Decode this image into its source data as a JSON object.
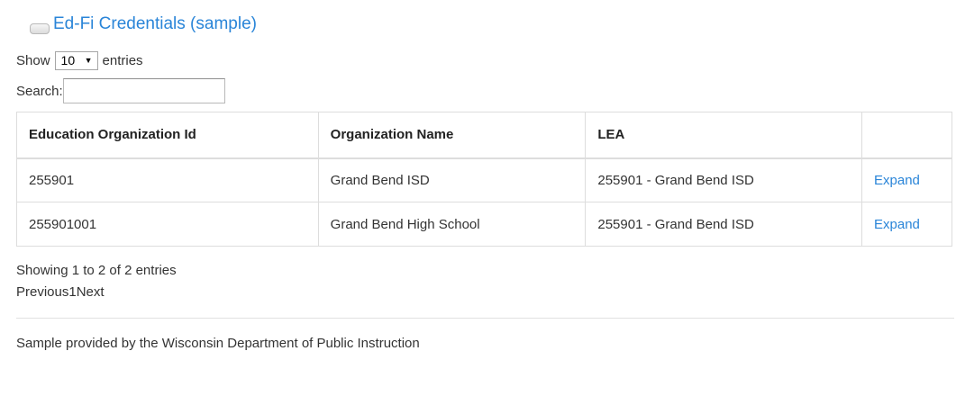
{
  "header": {
    "title": "Ed-Fi Credentials (sample)"
  },
  "length_menu": {
    "show_label": "Show",
    "selected_value": "10",
    "entries_label": "entries"
  },
  "search": {
    "label": "Search:",
    "value": ""
  },
  "table": {
    "columns": [
      "Education Organization Id",
      "Organization Name",
      "LEA",
      ""
    ],
    "rows": [
      {
        "ed_org_id": "255901",
        "org_name": "Grand Bend ISD",
        "lea": "255901 - Grand Bend ISD",
        "action": "Expand"
      },
      {
        "ed_org_id": "255901001",
        "org_name": "Grand Bend High School",
        "lea": "255901 - Grand Bend ISD",
        "action": "Expand"
      }
    ]
  },
  "info": {
    "text": "Showing 1 to 2 of 2 entries"
  },
  "pagination": {
    "previous": "Previous",
    "current": "1",
    "next": "Next"
  },
  "footer": {
    "text": "Sample provided by the Wisconsin Department of Public Instruction"
  },
  "colors": {
    "link": "#2a85d8",
    "border": "#dddddd"
  },
  "icons": {
    "toggle": "collapse-toggle-icon",
    "select_caret": "caret-down-icon"
  }
}
